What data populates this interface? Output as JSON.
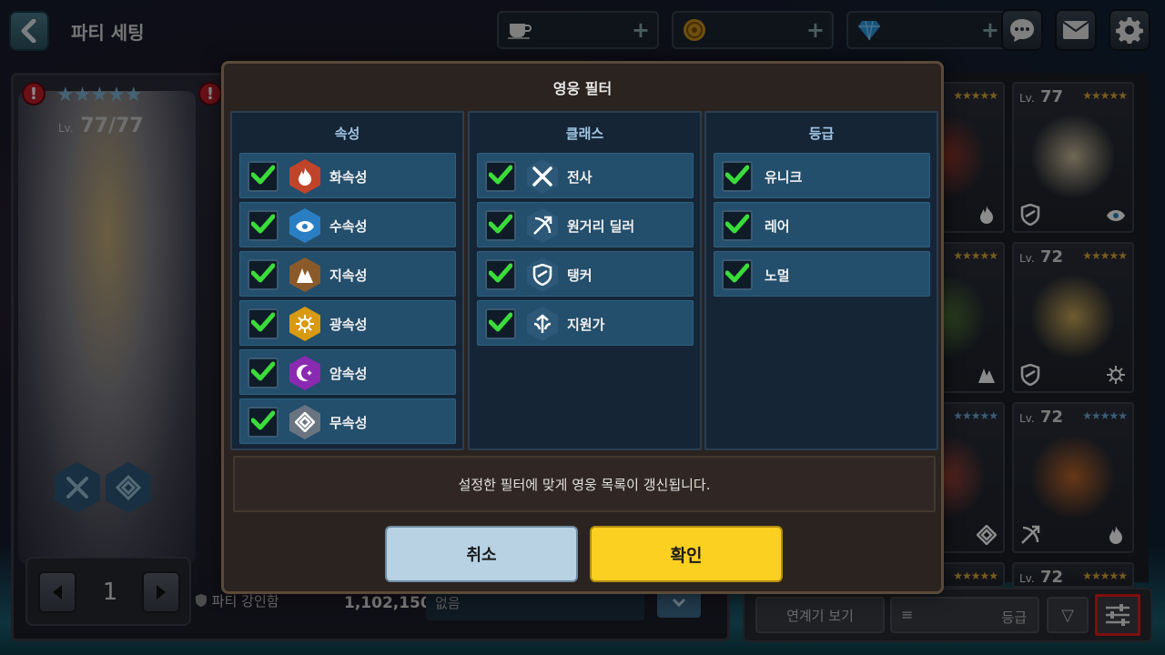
{
  "header": {
    "title": "파티 세팅",
    "currencies": [
      {
        "icon": "coffee-icon",
        "plus": "+"
      },
      {
        "icon": "gold-coin-icon",
        "plus": "+"
      },
      {
        "icon": "gem-icon",
        "plus": "+"
      }
    ]
  },
  "hero": {
    "stars": "★★★★★",
    "level_prefix": "Lv.",
    "level": "77/77"
  },
  "party": {
    "number": "1",
    "strength_label": "파티 강인함",
    "strength_value": "1,102,150",
    "linked_value": "없음"
  },
  "grid": {
    "cards": [
      {
        "lv": "",
        "stars": "★★★★★",
        "star_color": "gold",
        "sprite_color": "#b03a2a",
        "element": "fire-icon",
        "class": ""
      },
      {
        "lv": "77",
        "stars": "★★★★★",
        "star_color": "gold",
        "sprite_color": "#e8d8b0",
        "element": "water-icon",
        "class": "tank-icon"
      },
      {
        "lv": "",
        "stars": "★★★★★",
        "star_color": "gold",
        "sprite_color": "#5a8a3a",
        "element": "earth-icon",
        "class": ""
      },
      {
        "lv": "72",
        "stars": "★★★★★",
        "star_color": "gold",
        "sprite_color": "#e8c060",
        "element": "light-icon",
        "class": "tank-icon"
      },
      {
        "lv": "",
        "stars": "★★★★★",
        "star_color": "blue",
        "sprite_color": "#c04a3a",
        "element": "neutral-icon",
        "class": ""
      },
      {
        "lv": "72",
        "stars": "★★★★★",
        "star_color": "blue",
        "sprite_color": "#d8702a",
        "element": "fire-icon",
        "class": "ranged-icon"
      },
      {
        "lv": "",
        "stars": "★★★★★",
        "star_color": "gold",
        "sprite_color": "#444",
        "element": "",
        "class": ""
      },
      {
        "lv": "72",
        "stars": "★★★★★",
        "star_color": "gold",
        "sprite_color": "#444",
        "element": "",
        "class": ""
      }
    ]
  },
  "bottom": {
    "link_label": "연계기 보기",
    "sort_value": "등급",
    "sort_dir": "▽"
  },
  "modal": {
    "title": "영웅 필터",
    "columns": [
      {
        "header": "속성",
        "options": [
          {
            "label": "화속성",
            "icon": "fire-icon",
            "color": "#c0442a",
            "checked": true
          },
          {
            "label": "수속성",
            "icon": "water-icon",
            "color": "#2a7ec4",
            "checked": true
          },
          {
            "label": "지속성",
            "icon": "earth-icon",
            "color": "#8a5a2a",
            "checked": true
          },
          {
            "label": "광속성",
            "icon": "light-icon",
            "color": "#d89a10",
            "checked": true
          },
          {
            "label": "암속성",
            "icon": "dark-icon",
            "color": "#8a2ab0",
            "checked": true
          },
          {
            "label": "무속성",
            "icon": "neutral-icon",
            "color": "#6a7480",
            "checked": true
          }
        ]
      },
      {
        "header": "클래스",
        "options": [
          {
            "label": "전사",
            "icon": "warrior-icon",
            "color": "#2d5878",
            "checked": true
          },
          {
            "label": "원거리 딜러",
            "icon": "ranged-icon",
            "color": "#2d5878",
            "checked": true
          },
          {
            "label": "탱커",
            "icon": "tank-icon",
            "color": "#2d5878",
            "checked": true
          },
          {
            "label": "지원가",
            "icon": "support-icon",
            "color": "#2d5878",
            "checked": true
          }
        ]
      },
      {
        "header": "등급",
        "options": [
          {
            "label": "유니크",
            "checked": true
          },
          {
            "label": "레어",
            "checked": true
          },
          {
            "label": "노멀",
            "checked": true
          }
        ]
      }
    ],
    "info": "설정한 필터에 맞게 영웅 목록이 갱신됩니다.",
    "cancel_label": "취소",
    "ok_label": "확인"
  },
  "colors": {
    "check": "#3adc3a",
    "ok_button": "#fbd020",
    "cancel_button": "#b8d2e4",
    "highlight_border": "#e81a1a"
  }
}
